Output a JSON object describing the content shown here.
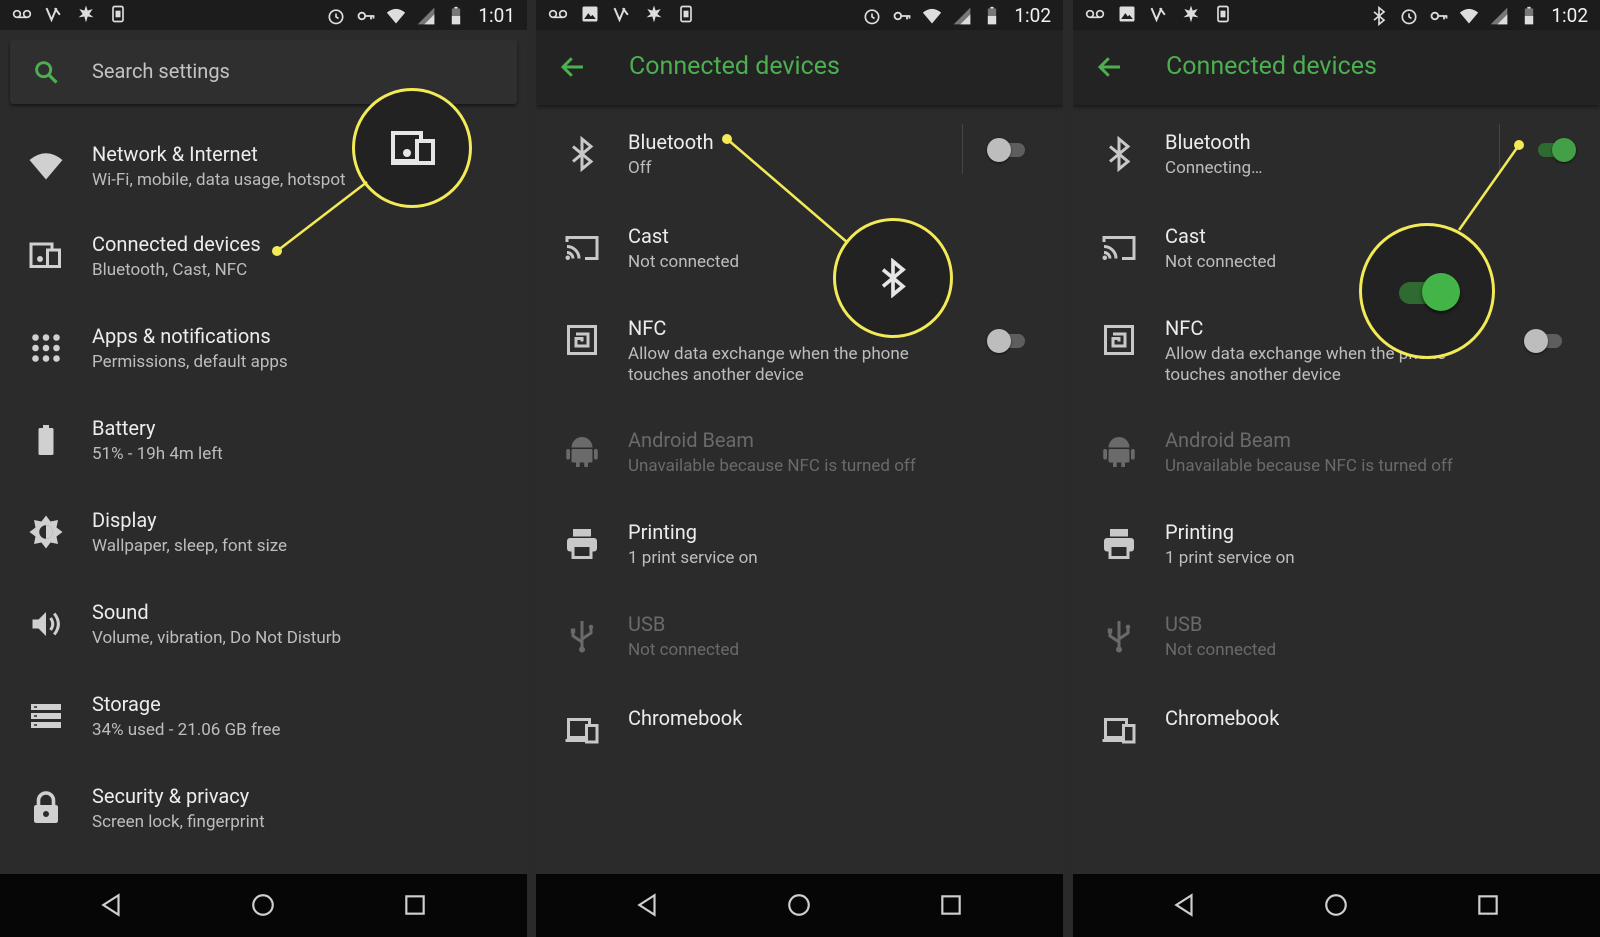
{
  "panels": {
    "settings": {
      "status_time": "1:01",
      "search_placeholder": "Search settings",
      "items": [
        {
          "title": "Network & Internet",
          "subtitle": "Wi-Fi, mobile, data usage, hotspot"
        },
        {
          "title": "Connected devices",
          "subtitle": "Bluetooth, Cast, NFC"
        },
        {
          "title": "Apps & notifications",
          "subtitle": "Permissions, default apps"
        },
        {
          "title": "Battery",
          "subtitle": "51% - 19h 4m left"
        },
        {
          "title": "Display",
          "subtitle": "Wallpaper, sleep, font size"
        },
        {
          "title": "Sound",
          "subtitle": "Volume, vibration, Do Not Disturb"
        },
        {
          "title": "Storage",
          "subtitle": "34% used - 21.06 GB free"
        },
        {
          "title": "Security & privacy",
          "subtitle": "Screen lock, fingerprint"
        }
      ]
    },
    "connected_off": {
      "status_time": "1:02",
      "title": "Connected devices",
      "items": [
        {
          "title": "Bluetooth",
          "subtitle": "Off"
        },
        {
          "title": "Cast",
          "subtitle": "Not connected"
        },
        {
          "title": "NFC",
          "subtitle": "Allow data exchange when the phone",
          "subtitle2": "touches another device"
        },
        {
          "title": "Android Beam",
          "subtitle": "Unavailable because NFC is turned off"
        },
        {
          "title": "Printing",
          "subtitle": "1 print service on"
        },
        {
          "title": "USB",
          "subtitle": "Not connected"
        },
        {
          "title": "Chromebook",
          "subtitle": ""
        }
      ],
      "bluetooth_on": false,
      "nfc_on": false
    },
    "connected_on": {
      "status_time": "1:02",
      "title": "Connected devices",
      "items": [
        {
          "title": "Bluetooth",
          "subtitle": "Connecting…"
        },
        {
          "title": "Cast",
          "subtitle": "Not connected"
        },
        {
          "title": "NFC",
          "subtitle": "Allow data exchange when the phone",
          "subtitle2": "touches another device"
        },
        {
          "title": "Android Beam",
          "subtitle": "Unavailable because NFC is turned off"
        },
        {
          "title": "Printing",
          "subtitle": "1 print service on"
        },
        {
          "title": "USB",
          "subtitle": "Not connected"
        },
        {
          "title": "Chromebook",
          "subtitle": ""
        }
      ],
      "bluetooth_on": true,
      "nfc_on": false
    }
  },
  "colors": {
    "accent": "#4caf50",
    "callout": "#f2ea56",
    "background": "#2b2b2c"
  }
}
